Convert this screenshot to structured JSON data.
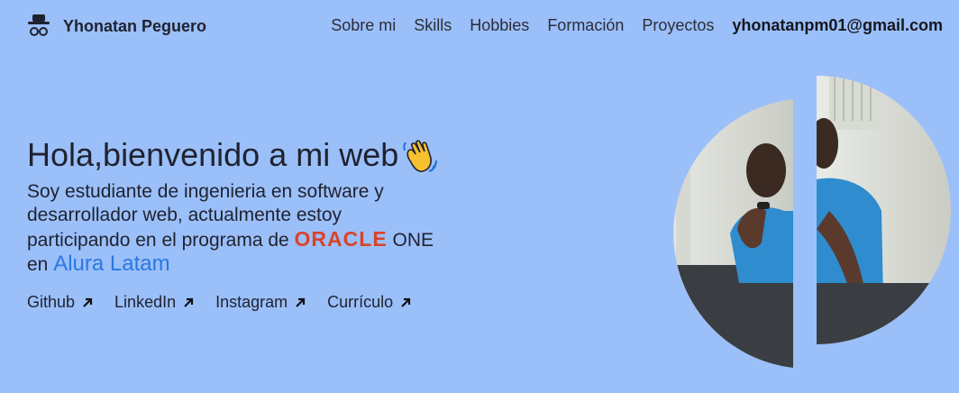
{
  "header": {
    "brand_name": "Yhonatan Peguero",
    "brand_icon": "incognito-hat-icon",
    "nav": [
      {
        "label": "Sobre mi"
      },
      {
        "label": "Skills"
      },
      {
        "label": "Hobbies"
      },
      {
        "label": "Formación"
      },
      {
        "label": "Proyectos"
      }
    ],
    "email": "yhonatanpm01@gmail.com"
  },
  "hero": {
    "greeting": "Hola,bienvenido a mi web",
    "wave_icon": "waving-hand-icon",
    "intro_line1": "Soy estudiante de ingenieria en software y",
    "intro_line2": "desarrollador web, actualmente estoy",
    "intro_line3": "participando en el programa de",
    "oracle": "ORACLE",
    "one": "ONE",
    "en": "en",
    "alura": "Alura Latam"
  },
  "links": [
    {
      "label": "Github",
      "icon": "arrow-up-right-icon"
    },
    {
      "label": "LinkedIn",
      "icon": "arrow-up-right-icon"
    },
    {
      "label": "Instagram",
      "icon": "arrow-up-right-icon"
    },
    {
      "label": "Currículo",
      "icon": "arrow-up-right-icon"
    }
  ],
  "colors": {
    "background": "#9bbff8",
    "accent": "#2a78e4",
    "oracle": "#d9432a",
    "text": "#1f2230"
  }
}
